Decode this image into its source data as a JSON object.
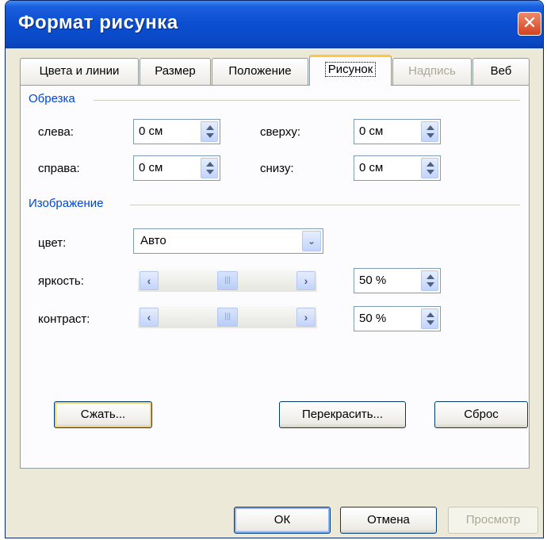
{
  "window": {
    "title": "Формат рисунка",
    "close_glyph": "✕"
  },
  "tabs": [
    {
      "label": "Цвета и линии"
    },
    {
      "label": "Размер"
    },
    {
      "label": "Положение"
    },
    {
      "label": "Рисунок"
    },
    {
      "label": "Надпись"
    },
    {
      "label": "Веб"
    }
  ],
  "crop": {
    "group_label": "Обрезка",
    "left_label": "слева:",
    "left_value": "0 см",
    "top_label": "сверху:",
    "top_value": "0 см",
    "right_label": "справа:",
    "right_value": "0 см",
    "bottom_label": "снизу:",
    "bottom_value": "0 см"
  },
  "image": {
    "group_label": "Изображение",
    "color_label": "цвет:",
    "color_value": "Авто",
    "brightness_label": "яркость:",
    "brightness_value": "50 %",
    "brightness_level": 0.5,
    "contrast_label": "контраст:",
    "contrast_value": "50 %",
    "contrast_level": 0.5
  },
  "actions": {
    "compress_label": "Сжать...",
    "recolor_label": "Перекрасить...",
    "reset_label": "Сброс"
  },
  "footer": {
    "ok_label": "ОК",
    "cancel_label": "Отмена",
    "preview_label": "Просмотр"
  },
  "glyphs": {
    "left_arrow": "‹",
    "right_arrow": "›",
    "drop_arrow": "⌄",
    "thumb_grip": "|||"
  },
  "colors": {
    "titlebar": "#0a4ecf",
    "dialog_bg": "#ece9d8",
    "group_label": "#0046d5",
    "tab_highlight": "#ffc73c"
  }
}
